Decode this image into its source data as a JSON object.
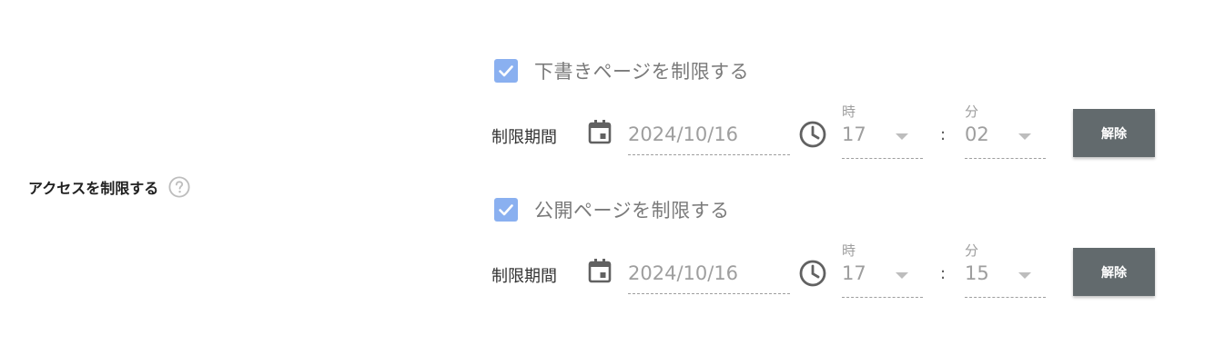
{
  "section": {
    "label": "アクセスを制限する",
    "help_icon": "help-circle-icon"
  },
  "colors": {
    "checkbox": "#8ab0f0",
    "button": "#626a6d",
    "muted_text": "#9e9e9e"
  },
  "groups": [
    {
      "checkbox_label": "下書きページを制限する",
      "checked": true,
      "period_label": "制限期間",
      "date_value": "2024/10/16",
      "hour_caption": "時",
      "hour_value": "17",
      "colon": ":",
      "minute_caption": "分",
      "minute_value": "02",
      "button_label": "解除"
    },
    {
      "checkbox_label": "公開ページを制限する",
      "checked": true,
      "period_label": "制限期間",
      "date_value": "2024/10/16",
      "hour_caption": "時",
      "hour_value": "17",
      "colon": ":",
      "minute_caption": "分",
      "minute_value": "15",
      "button_label": "解除"
    }
  ]
}
